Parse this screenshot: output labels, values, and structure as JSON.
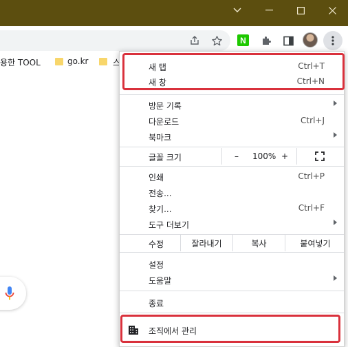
{
  "window": {
    "controls": [
      "chevron-down",
      "minimize",
      "maximize",
      "close"
    ]
  },
  "toolbar": {
    "icons": [
      "share-icon",
      "star-icon",
      "naver-extension-icon",
      "puzzle-icon",
      "side-panel-icon",
      "avatar",
      "kebab-menu-icon"
    ],
    "naver_label": "N"
  },
  "bookmarks": [
    {
      "label": "용한 TOOL"
    },
    {
      "label": "go.kr"
    },
    {
      "label": "스"
    }
  ],
  "menu": {
    "new_tab": {
      "label": "새 탭",
      "shortcut": "Ctrl+T"
    },
    "new_window": {
      "label": "새 창",
      "shortcut": "Ctrl+N"
    },
    "history": {
      "label": "방문 기록"
    },
    "downloads": {
      "label": "다운로드",
      "shortcut": "Ctrl+J"
    },
    "bookmarks": {
      "label": "북마크"
    },
    "zoom": {
      "label": "글꼴 크기",
      "minus": "–",
      "value": "100%",
      "plus": "+"
    },
    "print": {
      "label": "인쇄",
      "shortcut": "Ctrl+P"
    },
    "cast": {
      "label": "전송..."
    },
    "find": {
      "label": "찾기...",
      "shortcut": "Ctrl+F"
    },
    "more_tools": {
      "label": "도구 더보기"
    },
    "edit": {
      "label": "수정",
      "cut": "잘라내기",
      "copy": "복사",
      "paste": "붙여넣기"
    },
    "settings": {
      "label": "설정"
    },
    "help": {
      "label": "도움말"
    },
    "exit": {
      "label": "종료"
    },
    "managed": {
      "label": "조직에서 관리"
    }
  },
  "colors": {
    "titlebar": "#5c4e0f",
    "highlight": "#d9313c",
    "menu_bg": "#ffffff"
  }
}
